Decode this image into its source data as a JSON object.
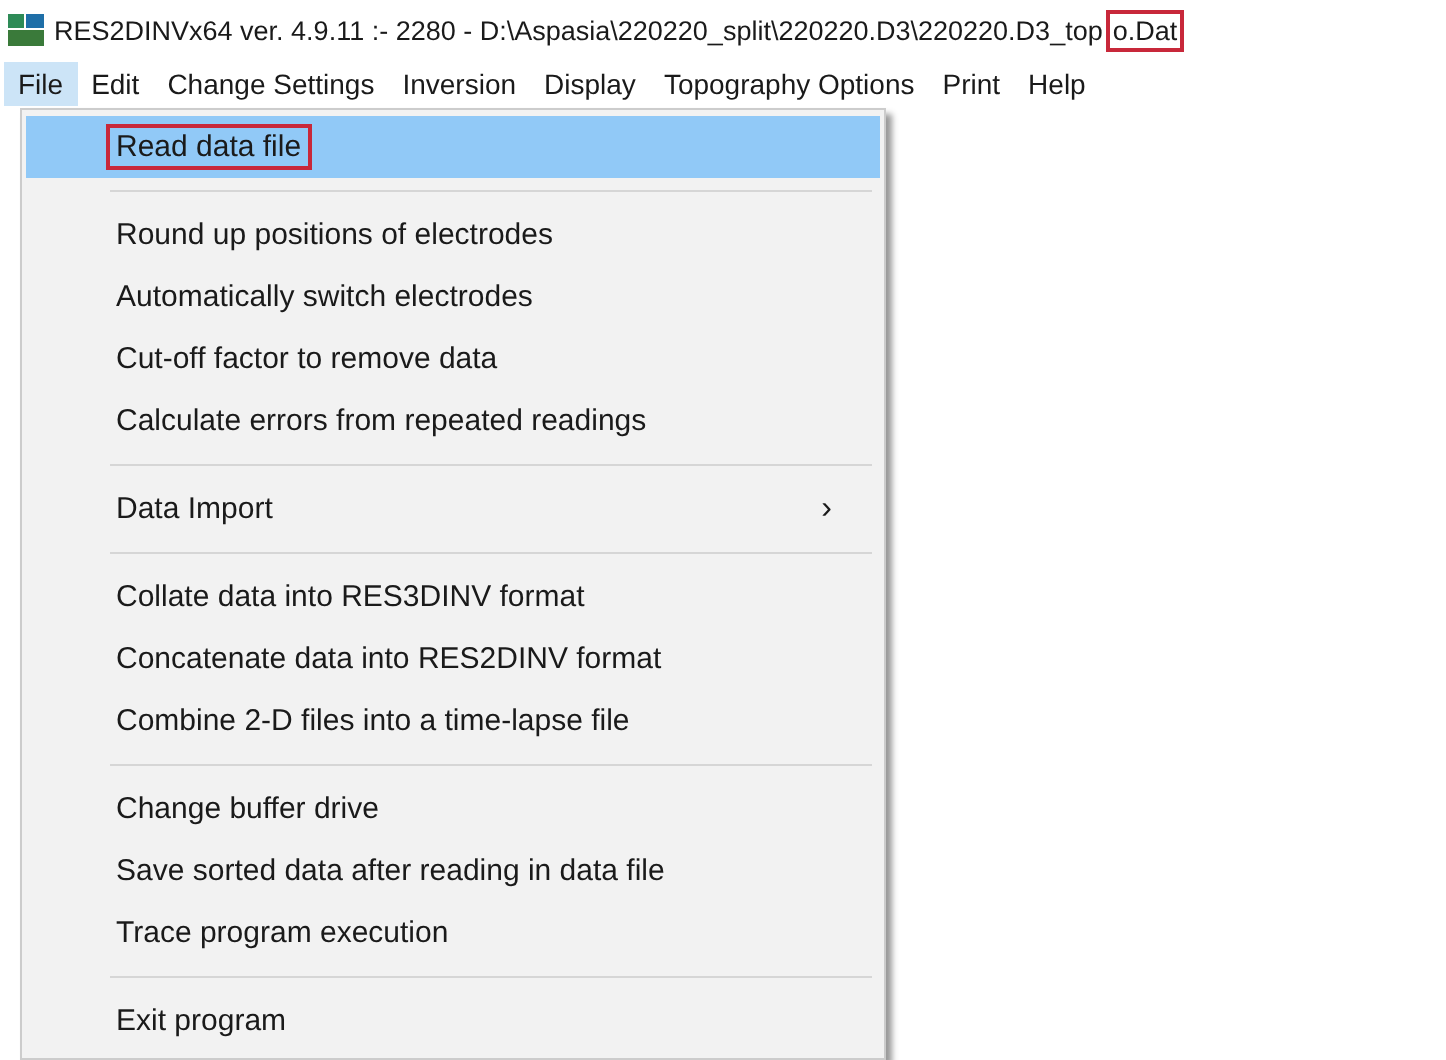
{
  "window": {
    "title_segments": [
      {
        "text": "RES2DINVx64 ver. 4.9.11 :- 2280 - D:\\Aspasia\\220220_split\\220220.D3\\220220.D3_top",
        "highlighted": false
      },
      {
        "text": "o.Dat",
        "highlighted": true
      }
    ]
  },
  "menu_bar": [
    {
      "label": "File",
      "selected": true
    },
    {
      "label": "Edit",
      "selected": false
    },
    {
      "label": "Change Settings",
      "selected": false
    },
    {
      "label": "Inversion",
      "selected": false
    },
    {
      "label": "Display",
      "selected": false
    },
    {
      "label": "Topography Options",
      "selected": false
    },
    {
      "label": "Print",
      "selected": false
    },
    {
      "label": "Help",
      "selected": false
    }
  ],
  "file_menu": [
    {
      "kind": "item",
      "label": "Read data file",
      "selected": true,
      "highlighted": true
    },
    {
      "kind": "separator"
    },
    {
      "kind": "item",
      "label": "Round up positions of electrodes",
      "selected": false,
      "highlighted": false
    },
    {
      "kind": "item",
      "label": "Automatically switch electrodes",
      "selected": false,
      "highlighted": false
    },
    {
      "kind": "item",
      "label": "Cut-off factor to remove data",
      "selected": false,
      "highlighted": false
    },
    {
      "kind": "item",
      "label": "Calculate errors from repeated readings",
      "selected": false,
      "highlighted": false
    },
    {
      "kind": "separator"
    },
    {
      "kind": "submenu",
      "label": "Data Import",
      "arrow": "›",
      "selected": false,
      "highlighted": false
    },
    {
      "kind": "separator"
    },
    {
      "kind": "item",
      "label": "Collate data into RES3DINV format",
      "selected": false,
      "highlighted": false
    },
    {
      "kind": "item",
      "label": "Concatenate data into RES2DINV format",
      "selected": false,
      "highlighted": false
    },
    {
      "kind": "item",
      "label": "Combine 2-D files into a time-lapse file",
      "selected": false,
      "highlighted": false
    },
    {
      "kind": "separator"
    },
    {
      "kind": "item",
      "label": "Change buffer drive",
      "selected": false,
      "highlighted": false
    },
    {
      "kind": "item",
      "label": "Save sorted data after reading in data file",
      "selected": false,
      "highlighted": false
    },
    {
      "kind": "item",
      "label": "Trace program execution",
      "selected": false,
      "highlighted": false
    },
    {
      "kind": "separator"
    },
    {
      "kind": "item",
      "label": "Exit program",
      "selected": false,
      "highlighted": false
    }
  ]
}
